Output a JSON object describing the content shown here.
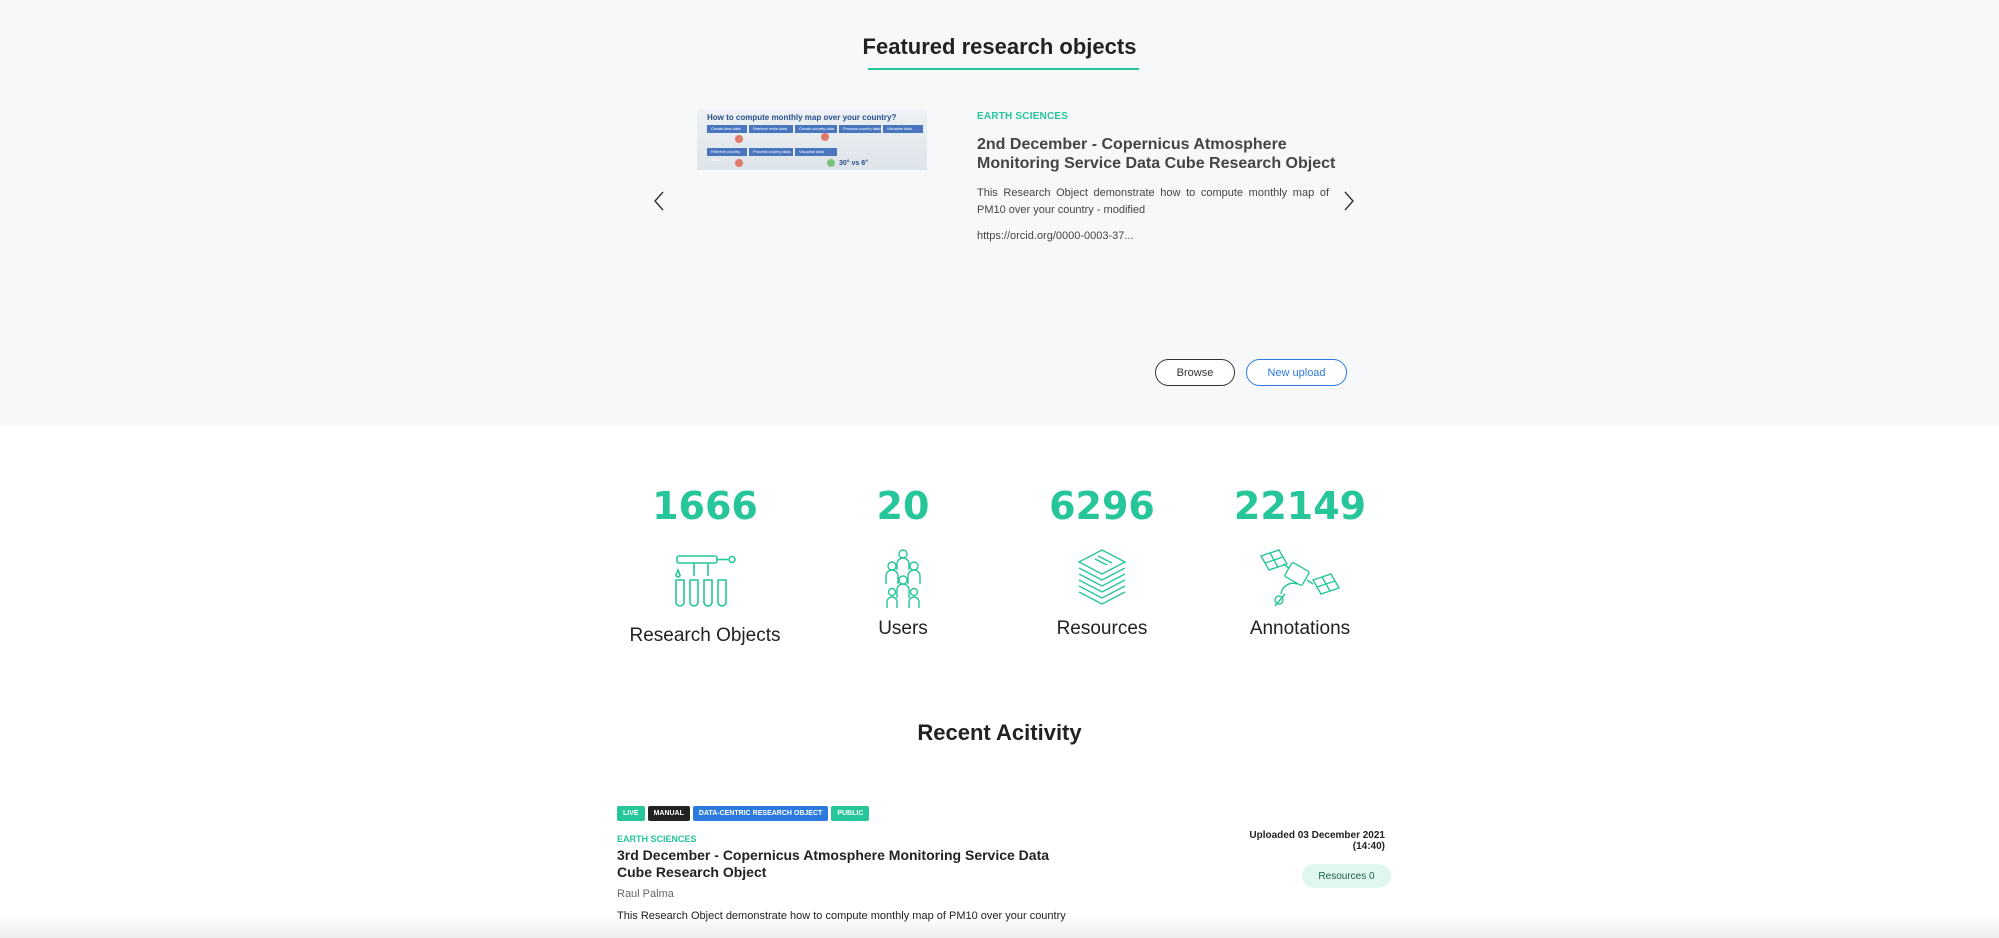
{
  "featured": {
    "title": "Featured research objects",
    "thumbnail": {
      "title": "How to compute monthly map over your country?",
      "steps_row1": [
        "Create time data",
        "Retrieve meta data",
        "Create country data",
        "Process country data",
        "Visualise data"
      ],
      "steps_row2": [
        "Retrieve country data",
        "Process country data",
        "Visualise data"
      ],
      "badge": "30° vs 6°"
    },
    "category": "EARTH SCIENCES",
    "item_title": "2nd December - Copernicus Atmosphere Monitoring Service Data Cube Research Object",
    "description": "This Research Object demonstrate how to compute monthly map of PM10 over your country - modified",
    "orcid": "https://orcid.org/0000-0003-37...",
    "browse_label": "Browse",
    "upload_label": "New upload"
  },
  "stats": [
    {
      "value": "1666",
      "label": "Research Objects",
      "icon": "test-tubes-icon"
    },
    {
      "value": "20",
      "label": "Users",
      "icon": "users-icon"
    },
    {
      "value": "6296",
      "label": "Resources",
      "icon": "document-stack-icon"
    },
    {
      "value": "22149",
      "label": "Annotations",
      "icon": "satellite-icon"
    }
  ],
  "recent": {
    "title": "Recent Acitivity",
    "tags": [
      "LIVE",
      "MANUAL",
      "DATA-CENTRIC RESEARCH OBJECT",
      "PUBLIC"
    ],
    "category": "EARTH SCIENCES",
    "item_title": "3rd December - Copernicus Atmosphere Monitoring Service Data Cube Research Object",
    "author": "Raul Palma",
    "description": "This Research Object demonstrate how to compute monthly map of PM10 over your country",
    "uploaded": "Uploaded  03 December 2021 (14:40)",
    "resources": "Resources 0"
  },
  "colors": {
    "accent": "#26c59a",
    "link": "#2c7ae0",
    "dark": "#222222"
  }
}
